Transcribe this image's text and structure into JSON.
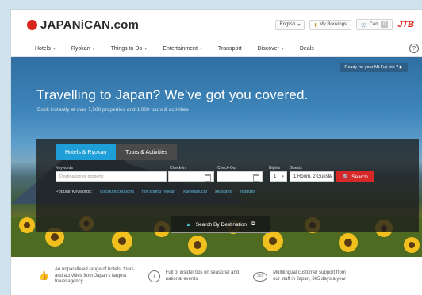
{
  "header": {
    "logo_text": "JAPANiCAN.com",
    "language": "English",
    "my_bookings": "My Bookings",
    "cart": "Cart",
    "cart_count": "0",
    "brand_mark": "JTB"
  },
  "nav": {
    "items": [
      {
        "label": "Hotels",
        "dropdown": true
      },
      {
        "label": "Ryokan",
        "dropdown": true
      },
      {
        "label": "Things to Do",
        "dropdown": true
      },
      {
        "label": "Entertainment",
        "dropdown": true
      },
      {
        "label": "Transport",
        "dropdown": false
      },
      {
        "label": "Discover",
        "dropdown": true
      },
      {
        "label": "Deals",
        "dropdown": false
      }
    ],
    "help": "?"
  },
  "hero": {
    "promo": "Ready for your Mt.Fuji trip ? ▶",
    "headline": "Travelling to Japan? We've got you covered.",
    "subline": "Book instantly at over 7,500 properties and 1,000 tours & activities"
  },
  "search": {
    "tabs": [
      "Hotels & Ryokan",
      "Tours & Activities"
    ],
    "labels": {
      "keywords": "Keywords",
      "checkin": "Check-in",
      "checkout": "Check-Out",
      "nights": "Nights",
      "guests": "Guests"
    },
    "keyword_placeholder": "Destination or property",
    "nights_value": "1",
    "guests_value": "1 Room, 2 Guests",
    "search_button": "Search",
    "popular_label": "Popular Keywords:",
    "popular_keywords": [
      "discount coupons",
      "hot spring ryokan",
      "kanegafuchi",
      "ski stays",
      "includes"
    ],
    "destination_button": "Search By Destination"
  },
  "features": [
    {
      "icon": "thumbs-up-icon",
      "text_lines": [
        "An unparalleled range of hotels, tours",
        "and activities from Japan's largest",
        "travel agency."
      ]
    },
    {
      "icon": "info-icon",
      "text_lines": [
        "Full of insider tips on seasonal and",
        "national events."
      ]
    },
    {
      "icon": "support-365-icon",
      "badge": "365",
      "text_lines": [
        "Multilingual customer support from",
        "our staff in Japan, 365 days a year"
      ]
    }
  ]
}
